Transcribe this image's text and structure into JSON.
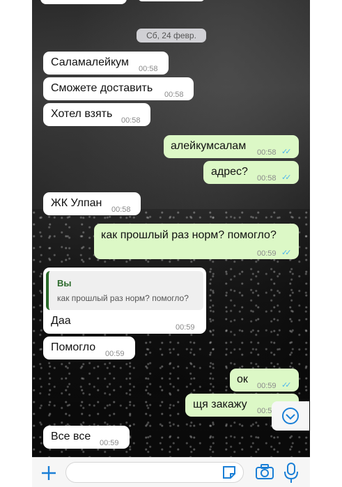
{
  "date_separator": "Сб, 24 февр.",
  "messages": [
    {
      "text": "Саламалейкум",
      "time": "00:58"
    },
    {
      "text": "Сможете доставить",
      "time": "00:58"
    },
    {
      "text": "Хотел взять",
      "time": "00:58"
    },
    {
      "text": "алейкумсалам",
      "time": "00:58",
      "status": "✓✓"
    },
    {
      "text": "адрес?",
      "time": "00:58",
      "status": "✓✓"
    },
    {
      "text": "ЖК Улпан",
      "time": "00:58"
    },
    {
      "text": "как прошлый раз норм? помогло?",
      "time": "00:59",
      "status": "✓✓"
    },
    {
      "text": "Даа",
      "time": "00:59",
      "quote_author": "Вы",
      "quote_text": "как прошлый раз норм? помогло?"
    },
    {
      "text": "Помогло",
      "time": "00:59"
    },
    {
      "text": "ок",
      "time": "00:59",
      "status": "✓✓"
    },
    {
      "text": "щя закажу",
      "time": "00:5"
    },
    {
      "text": "Все все",
      "time": "00:59"
    }
  ],
  "icons": {
    "attach": "plus-icon",
    "sticker": "sticker-icon",
    "camera": "camera-icon",
    "mic": "microphone-icon",
    "scroll": "chevron-down-icon"
  },
  "colors": {
    "incoming": "#ffffff",
    "outgoing": "#dcf8c6",
    "accent": "#1a7fd6",
    "read_ticks": "#4fb6ec"
  }
}
